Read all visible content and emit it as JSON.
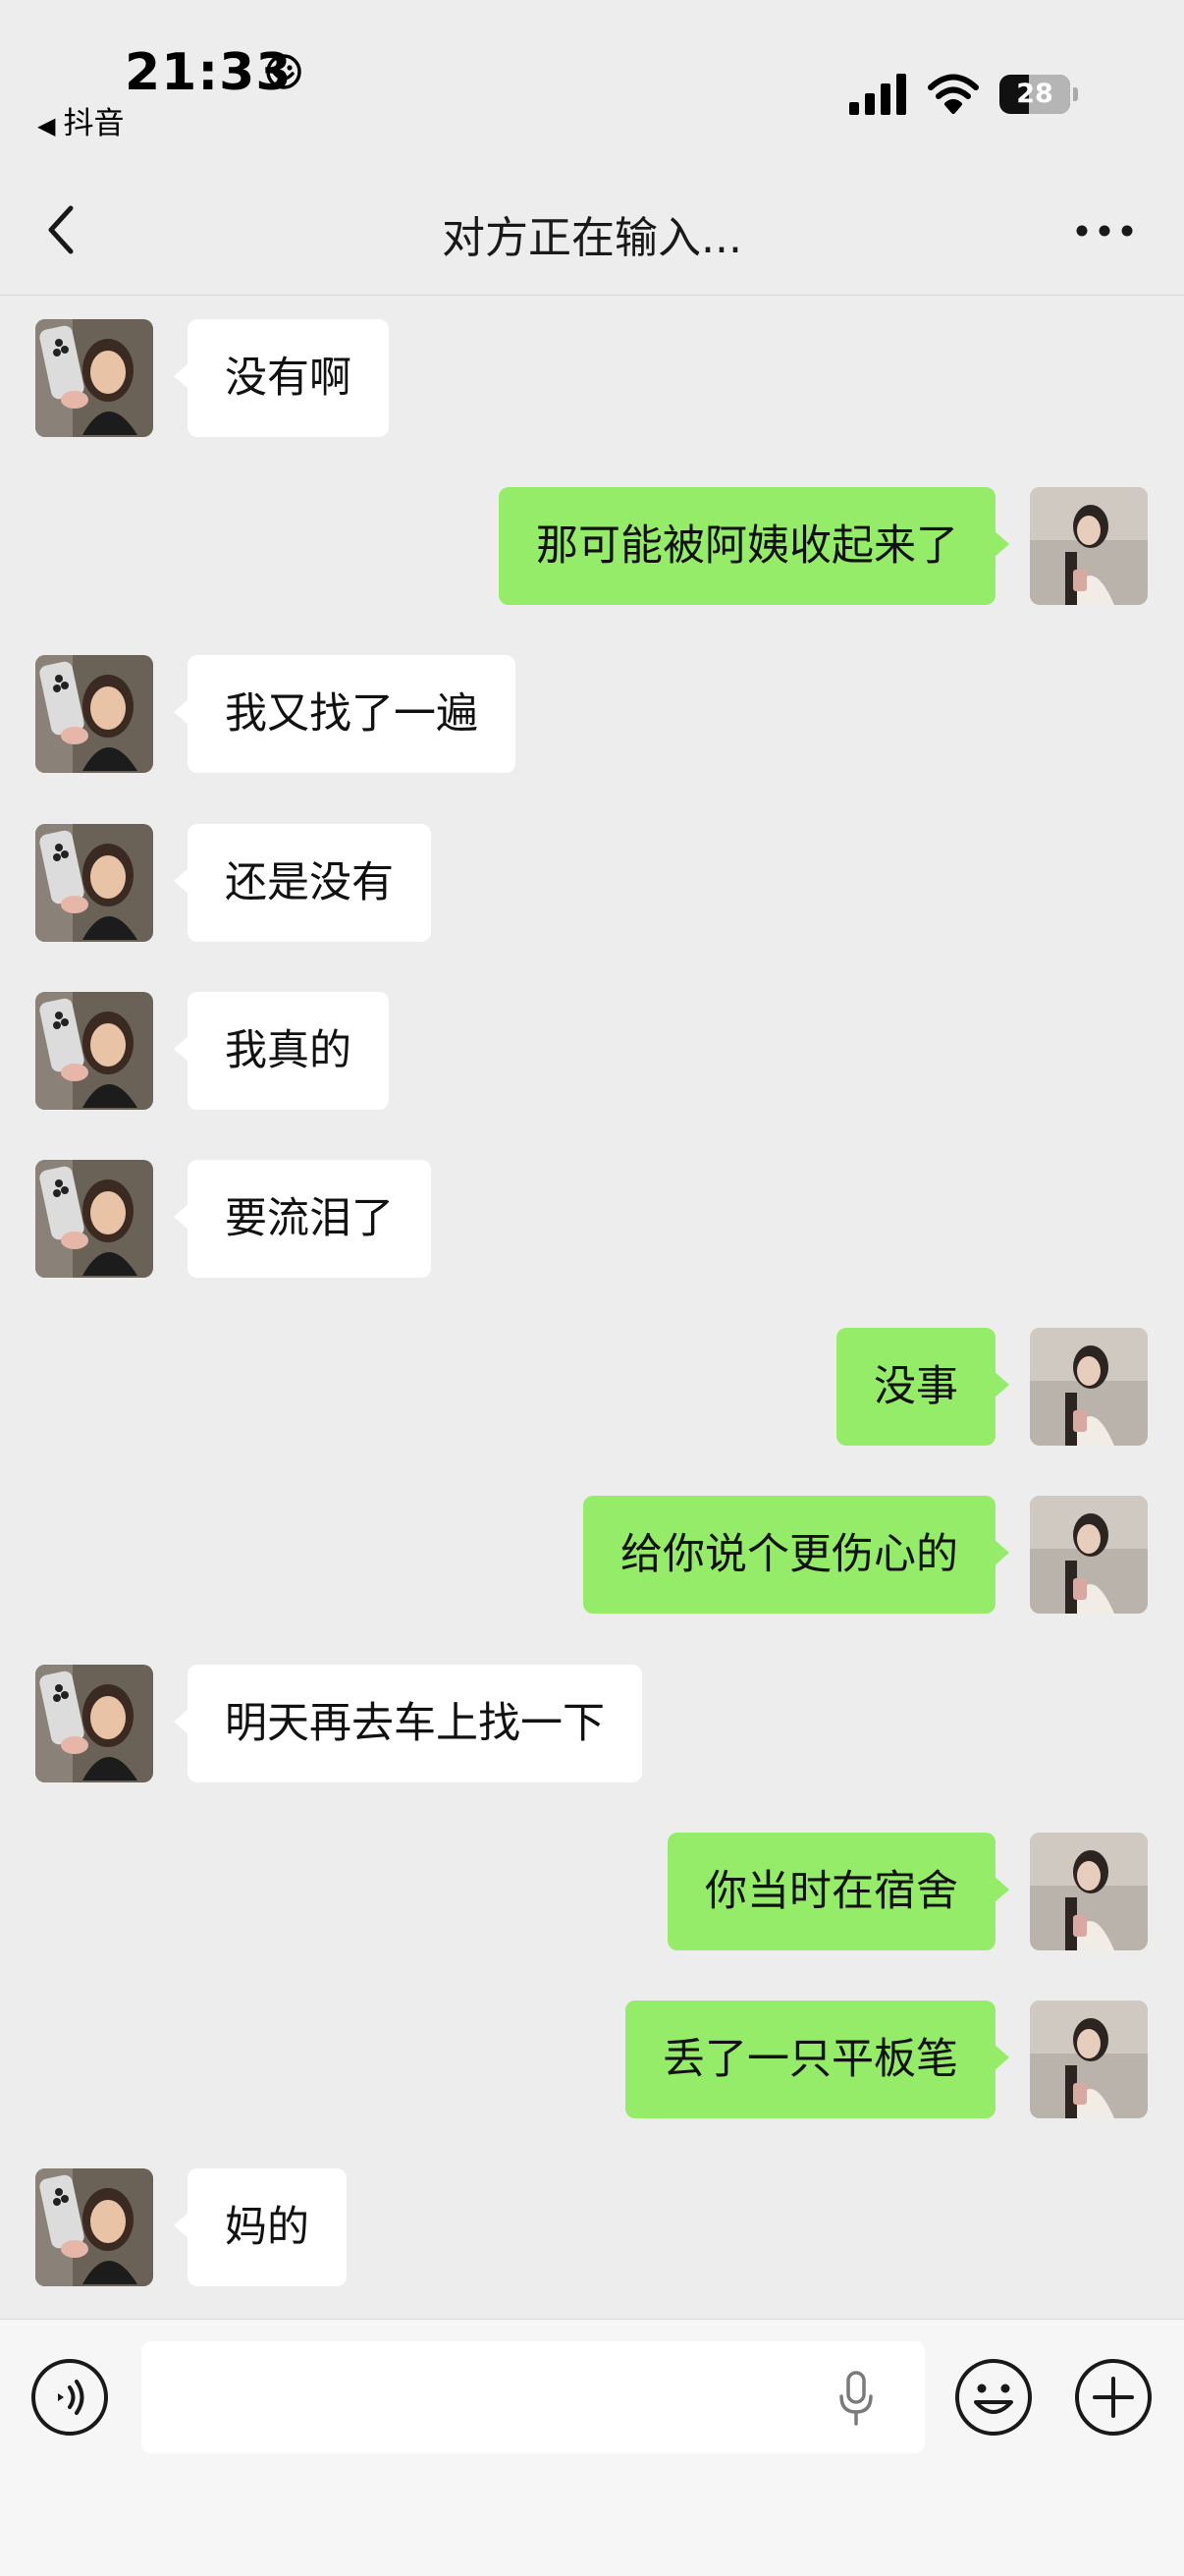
{
  "status_bar": {
    "time": "21:33",
    "back_app": "抖音",
    "battery": "28"
  },
  "nav": {
    "title": "对方正在输入..."
  },
  "messages": [
    {
      "side": "left",
      "text": "没有啊"
    },
    {
      "side": "right",
      "text": "那可能被阿姨收起来了"
    },
    {
      "side": "left",
      "text": "我又找了一遍"
    },
    {
      "side": "left",
      "text": "还是没有"
    },
    {
      "side": "left",
      "text": "我真的"
    },
    {
      "side": "left",
      "text": "要流泪了"
    },
    {
      "side": "right",
      "text": "没事"
    },
    {
      "side": "right",
      "text": "给你说个更伤心的"
    },
    {
      "side": "left",
      "text": "明天再去车上找一下"
    },
    {
      "side": "right",
      "text": "你当时在宿舍"
    },
    {
      "side": "right",
      "text": "丢了一只平板笔"
    },
    {
      "side": "left",
      "text": "妈的"
    }
  ],
  "input_bar": {
    "text_value": "",
    "icons": [
      "voice-icon",
      "microphone-icon",
      "emoji-icon",
      "plus-icon"
    ]
  },
  "colors": {
    "background": "#ededed",
    "outgoing_bubble": "#95ec69",
    "incoming_bubble": "#ffffff"
  }
}
